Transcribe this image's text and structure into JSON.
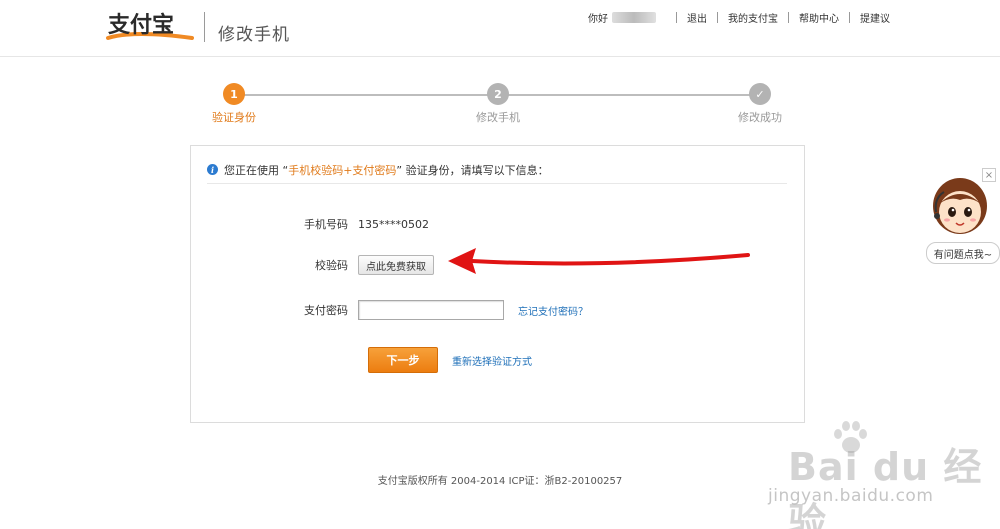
{
  "header": {
    "logo_text": "支付宝",
    "page_title": "修改手机",
    "greeting": "你好",
    "nav": [
      "退出",
      "我的支付宝",
      "帮助中心",
      "提建议"
    ]
  },
  "steps": [
    {
      "number": "1",
      "label": "验证身份",
      "state": "active"
    },
    {
      "number": "2",
      "label": "修改手机",
      "state": "pending"
    },
    {
      "number": "✓",
      "label": "修改成功",
      "state": "pending"
    }
  ],
  "form": {
    "notice_prefix": "您正在使用 “",
    "notice_highlight": "手机校验码+支付密码",
    "notice_suffix": "” 验证身份，请填写以下信息：",
    "phone_label": "手机号码",
    "phone_value": "135****0502",
    "code_label": "校验码",
    "code_button": "点此免费获取",
    "password_label": "支付密码",
    "password_value": "",
    "forgot_link": "忘记支付密码？",
    "next_button": "下一步",
    "reselect_link": "重新选择验证方式"
  },
  "footer": {
    "copyright": "支付宝版权所有 2004-2014 ICP证：浙B2-20100257"
  },
  "helper": {
    "close": "×",
    "bubble": "有问题点我~"
  },
  "watermark": {
    "brand": "Bai du 经验",
    "url": "jingyan.baidu.com"
  },
  "colors": {
    "accent": "#f08a24",
    "link": "#1e6fb8",
    "arrow": "#e01414"
  }
}
